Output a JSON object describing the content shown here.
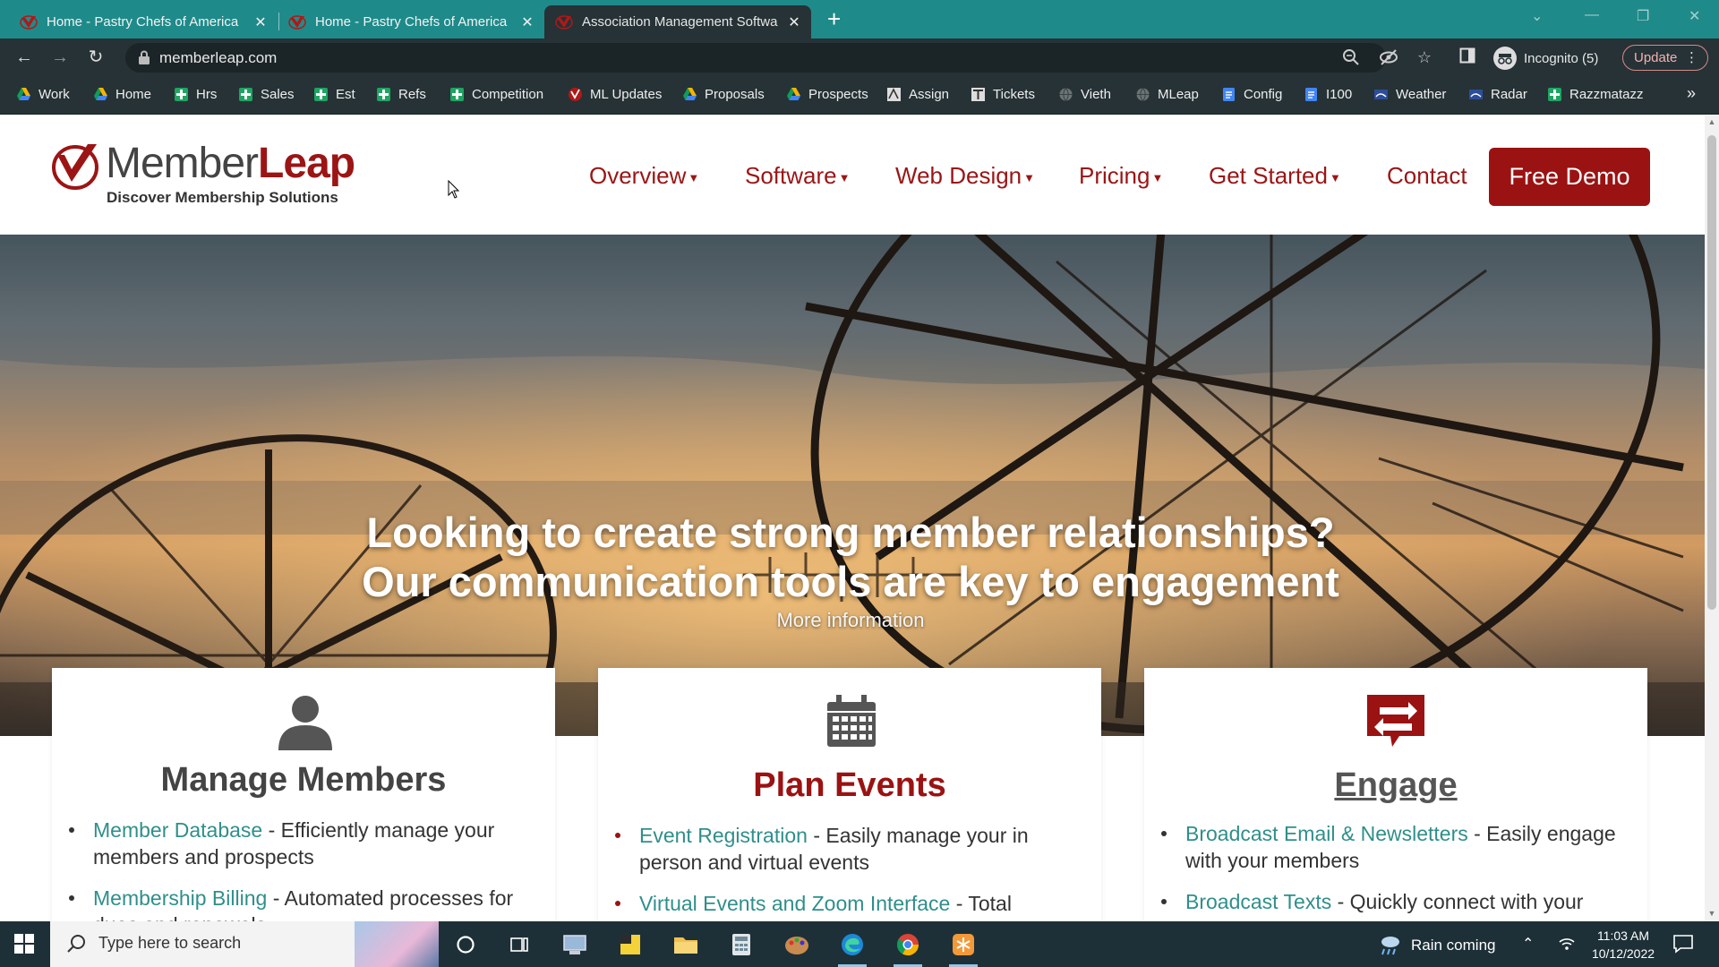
{
  "browser": {
    "tabs": [
      {
        "title": "Home - Pastry Chefs of America",
        "active": false
      },
      {
        "title": "Home - Pastry Chefs of America",
        "active": false
      },
      {
        "title": "Association Management Softwa",
        "active": true
      }
    ],
    "new_tab_symbol": "+",
    "close_symbol": "✕",
    "url": "memberleap.com",
    "incognito_label": "Incognito (5)",
    "update_label": "Update",
    "bookmarks": [
      {
        "label": "Work",
        "icon": "drive-icon"
      },
      {
        "label": "Home",
        "icon": "drive-icon"
      },
      {
        "label": "Hrs",
        "icon": "sheets-icon"
      },
      {
        "label": "Sales",
        "icon": "sheets-icon"
      },
      {
        "label": "Est",
        "icon": "sheets-icon"
      },
      {
        "label": "Refs",
        "icon": "sheets-icon"
      },
      {
        "label": "Competition",
        "icon": "sheets-icon"
      },
      {
        "label": "ML Updates",
        "icon": "memberleap-icon"
      },
      {
        "label": "Proposals",
        "icon": "drive-icon"
      },
      {
        "label": "Prospects",
        "icon": "drive-icon"
      },
      {
        "label": "Assign",
        "icon": "assign-icon"
      },
      {
        "label": "Tickets",
        "icon": "tickets-icon"
      },
      {
        "label": "Vieth",
        "icon": "globe-icon"
      },
      {
        "label": "MLeap",
        "icon": "globe-icon"
      },
      {
        "label": "Config",
        "icon": "docs-icon"
      },
      {
        "label": "I100",
        "icon": "docs-icon"
      },
      {
        "label": "Weather",
        "icon": "weather-icon"
      },
      {
        "label": "Radar",
        "icon": "weather-icon"
      },
      {
        "label": "Razzmatazz",
        "icon": "sheets-icon"
      }
    ],
    "more_bookmarks_symbol": "»"
  },
  "site": {
    "logo_member": "Member",
    "logo_leap": "Leap",
    "logo_tagline": "Discover Membership Solutions",
    "nav": [
      {
        "label": "Overview",
        "dropdown": true
      },
      {
        "label": "Software",
        "dropdown": true
      },
      {
        "label": "Web Design",
        "dropdown": true
      },
      {
        "label": "Pricing",
        "dropdown": true
      },
      {
        "label": "Get Started",
        "dropdown": true
      },
      {
        "label": "Contact",
        "dropdown": false
      }
    ],
    "demo_button": "Free Demo",
    "hero": {
      "line1": "Looking to create strong member relationships?",
      "line2": "Our communication tools are key to engagement",
      "more": "More information"
    },
    "cards": [
      {
        "title": "Manage Members",
        "icon": "person-icon",
        "items": [
          {
            "link": "Member Database",
            "text": " - Efficiently manage your members and prospects"
          },
          {
            "link": "Membership Billing",
            "text": " - Automated processes for dues and renewals"
          }
        ]
      },
      {
        "title": "Plan Events",
        "icon": "calendar-icon",
        "items": [
          {
            "link": "Event Registration",
            "text": " - Easily manage your in person and virtual events"
          },
          {
            "link": "Virtual Events and Zoom Interface",
            "text": " - Total"
          }
        ]
      },
      {
        "title": "Engage",
        "icon": "exchange-icon",
        "items": [
          {
            "link": "Broadcast Email & Newsletters",
            "text": " - Easily engage with your members"
          },
          {
            "link": "Broadcast Texts",
            "text": " - Quickly connect with your"
          }
        ]
      }
    ]
  },
  "taskbar": {
    "search_placeholder": "Type here to search",
    "weather": "Rain coming",
    "time": "11:03 AM",
    "date": "10/12/2022"
  },
  "colors": {
    "tab_bar": "#1f8a8a",
    "chrome_dark": "#263236",
    "brand_red": "#9b1212",
    "link_teal": "#2f8f8a",
    "taskbar": "#1e3037"
  }
}
